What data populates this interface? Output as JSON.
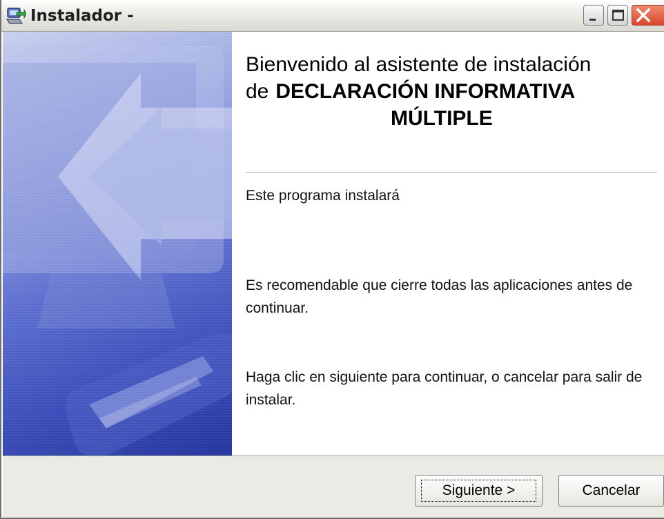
{
  "window": {
    "title": "Instalador -",
    "icon": "installer-icon",
    "controls": [
      "minimize-icon",
      "maximize-icon",
      "close-icon"
    ]
  },
  "welcome": {
    "heading_line1": "Bienvenido al asistente de instalación",
    "heading_prefix": "de",
    "product_line1": "DECLARACIÓN INFORMATIVA",
    "product_line2": "MÚLTIPLE",
    "intro": "Este programa instalará",
    "recommendation": "Es recomendable que cierre todas las aplicaciones antes de continuar.",
    "instructions": "Haga clic en siguiente para continuar, o cancelar para salir de instalar."
  },
  "buttons": {
    "next_label": "Siguiente >",
    "cancel_label": "Cancelar"
  },
  "colors": {
    "banner_top": "#c8d0ee",
    "banner_bottom": "#23339d",
    "close_button": "#d8472c",
    "dialog_bar": "#ebebe6"
  }
}
